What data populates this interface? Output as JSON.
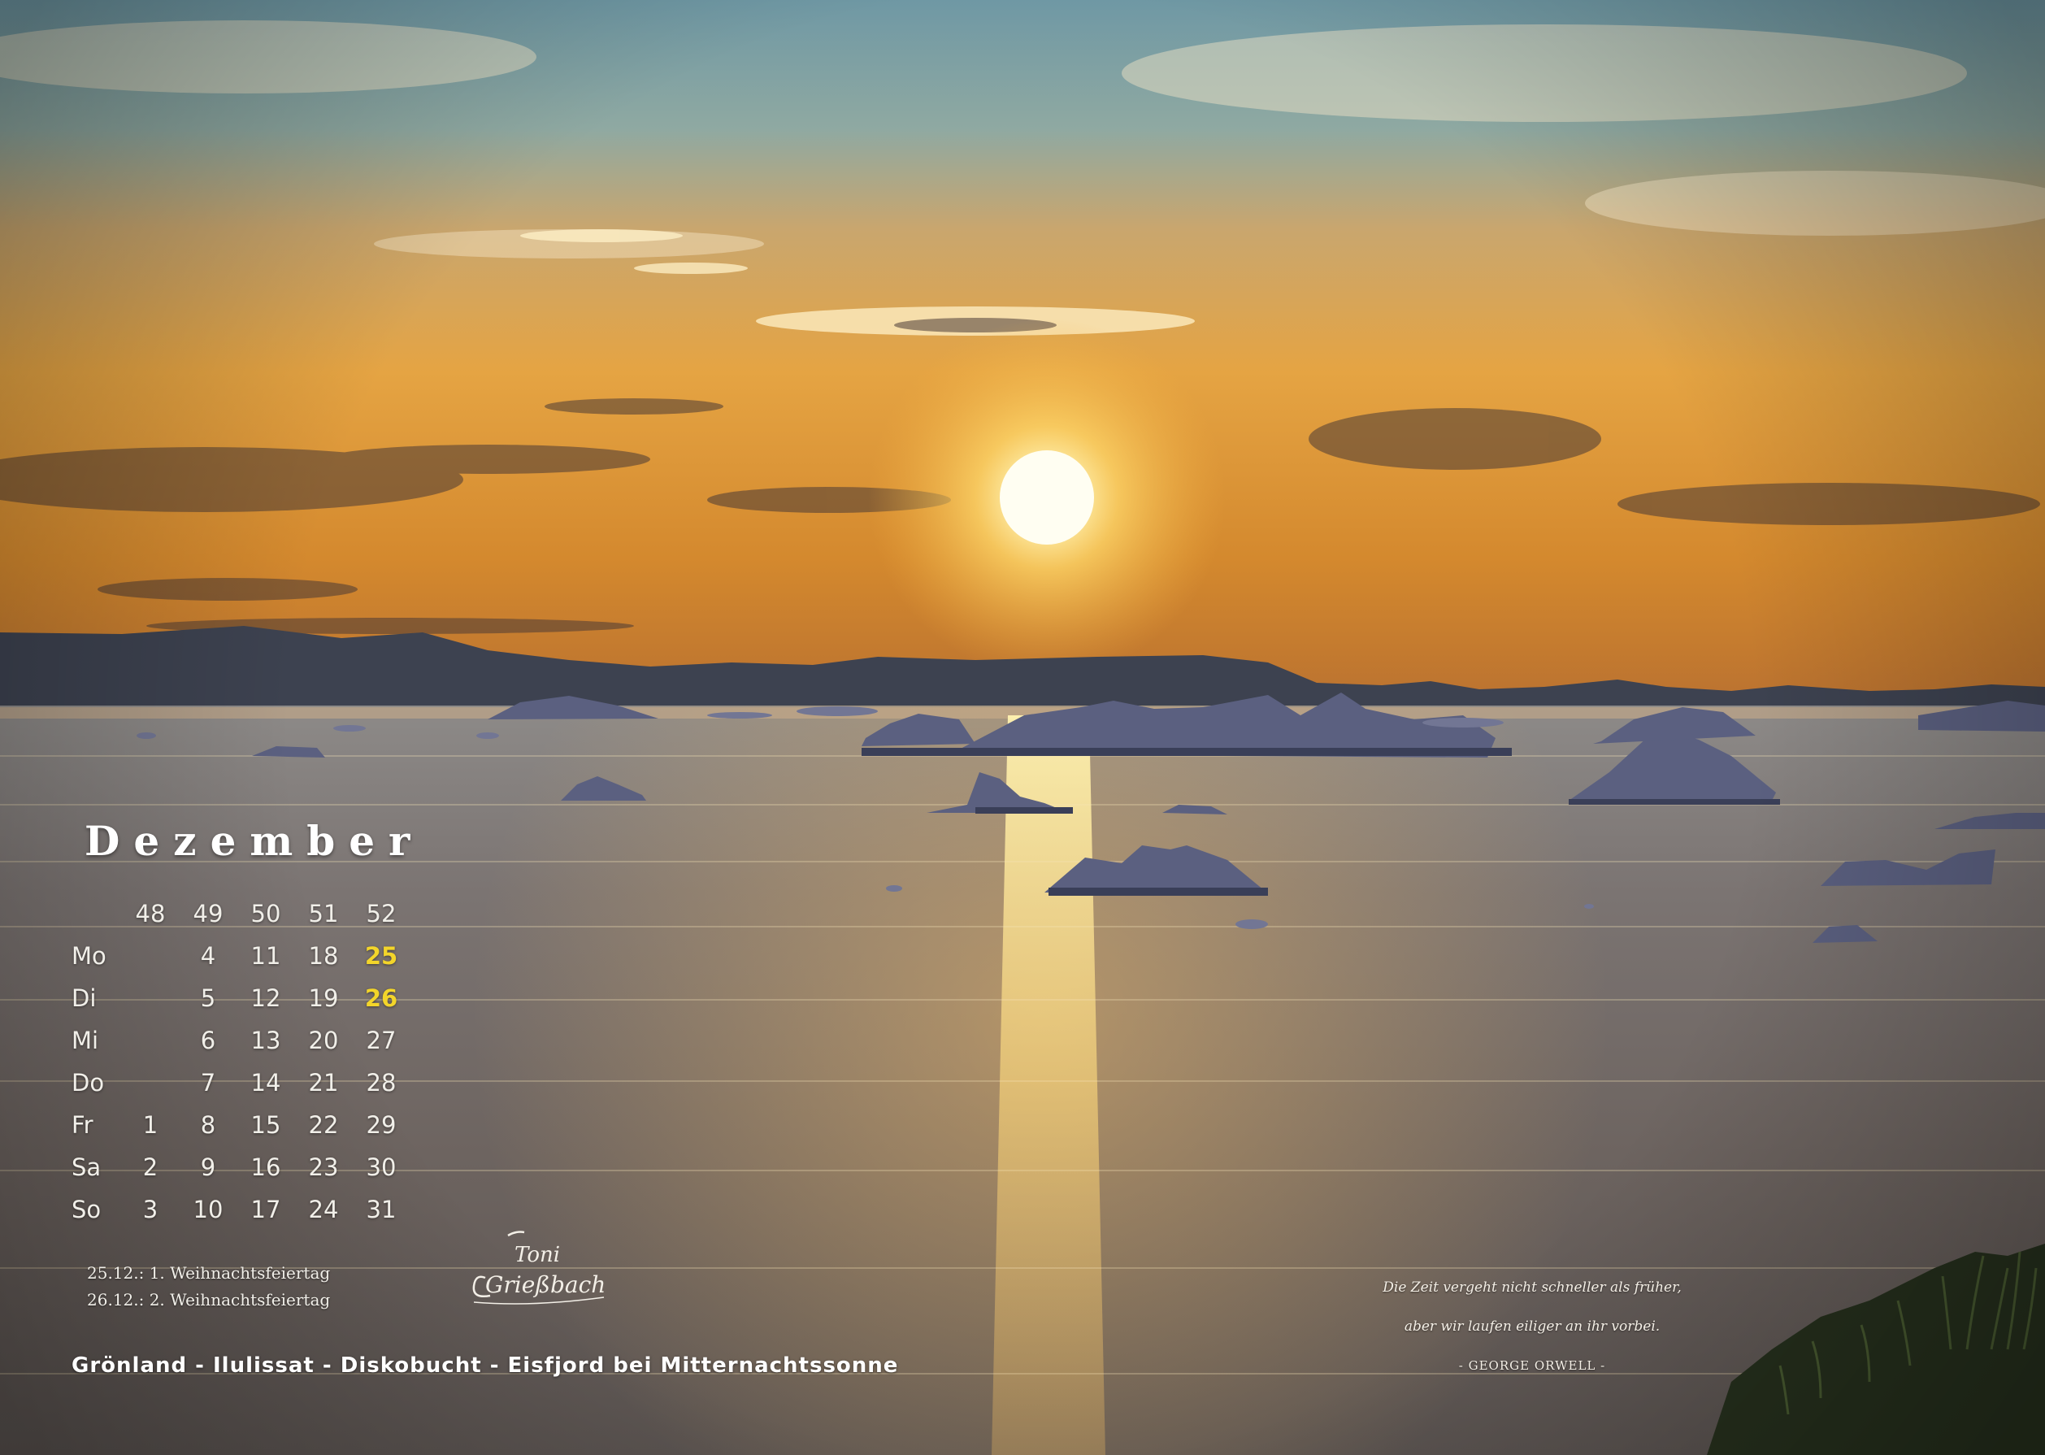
{
  "month": "Dezember",
  "calendar": {
    "week_numbers": [
      "48",
      "49",
      "50",
      "51",
      "52"
    ],
    "rows": [
      {
        "day": "Mo",
        "cells": [
          "",
          "4",
          "11",
          "18",
          "25"
        ],
        "holiday_col": 4
      },
      {
        "day": "Di",
        "cells": [
          "",
          "5",
          "12",
          "19",
          "26"
        ],
        "holiday_col": 4
      },
      {
        "day": "Mi",
        "cells": [
          "",
          "6",
          "13",
          "20",
          "27"
        ],
        "holiday_col": -1
      },
      {
        "day": "Do",
        "cells": [
          "",
          "7",
          "14",
          "21",
          "28"
        ],
        "holiday_col": -1
      },
      {
        "day": "Fr",
        "cells": [
          "1",
          "8",
          "15",
          "22",
          "29"
        ],
        "holiday_col": -1
      },
      {
        "day": "Sa",
        "cells": [
          "2",
          "9",
          "16",
          "23",
          "30"
        ],
        "holiday_col": -1
      },
      {
        "day": "So",
        "cells": [
          "3",
          "10",
          "17",
          "24",
          "31"
        ],
        "holiday_col": -1
      }
    ],
    "holiday_color": "#f3d52a"
  },
  "holidays": [
    "25.12.: 1. Weihnachtsfeiertag",
    "26.12.: 2. Weihnachtsfeiertag"
  ],
  "location": "Grönland - Ilulissat - Diskobucht - Eisfjord bei Mitternachtssonne",
  "quote": {
    "line1": "Die Zeit vergeht nicht schneller als früher,",
    "line2": "aber wir laufen eiliger an ihr vorbei.",
    "author": "- GEORGE ORWELL -"
  },
  "signature": {
    "line1": "Toni",
    "line2": "Grießbach"
  }
}
